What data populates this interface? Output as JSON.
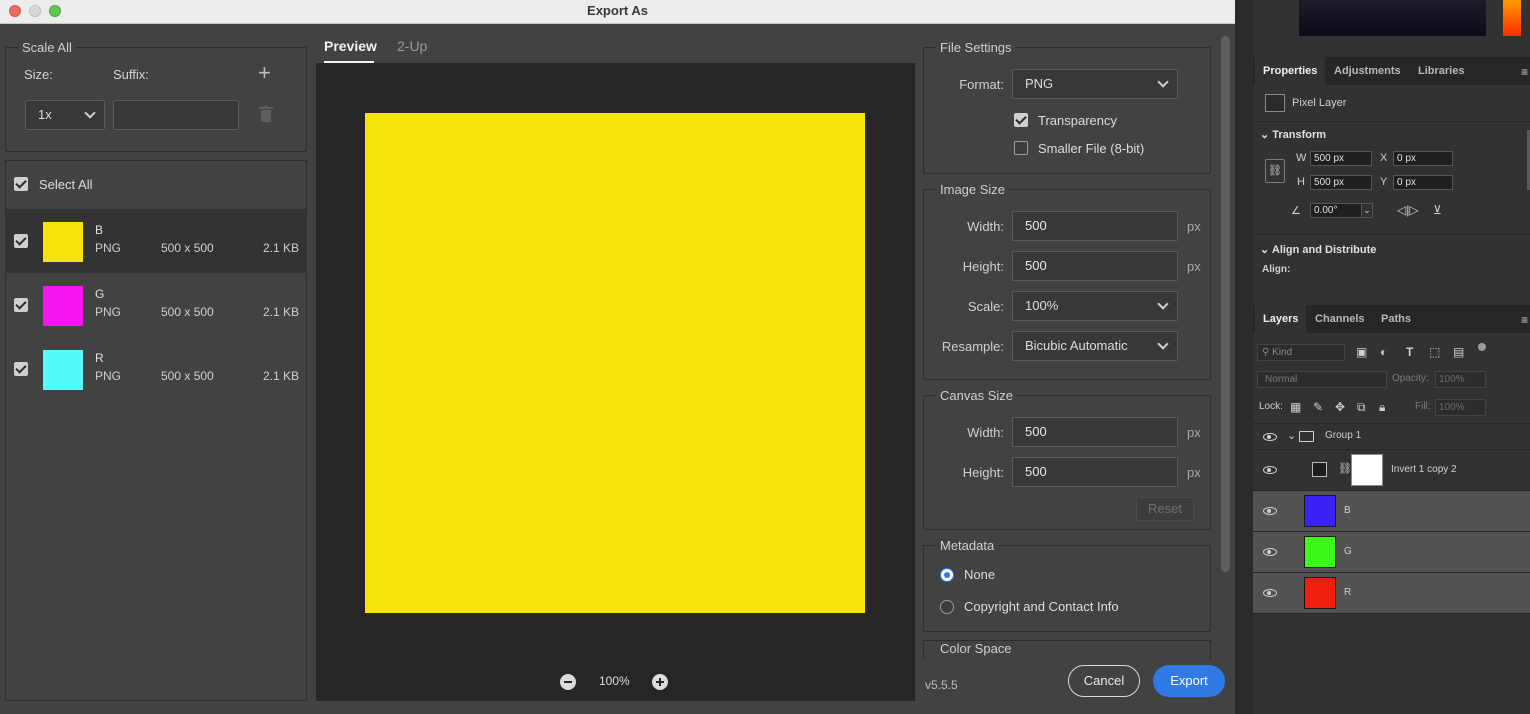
{
  "window": {
    "title": "Export As"
  },
  "scale_all": {
    "legend": "Scale All",
    "size_label": "Size:",
    "suffix_label": "Suffix:",
    "size_value": "1x",
    "suffix_value": ""
  },
  "assets": {
    "select_all": "Select All",
    "items": [
      {
        "name": "B",
        "format": "PNG",
        "dims": "500 x 500",
        "size": "2.1 KB",
        "color": "#f5e30a",
        "checked": true
      },
      {
        "name": "G",
        "format": "PNG",
        "dims": "500 x 500",
        "size": "2.1 KB",
        "color": "#f516f0",
        "checked": true
      },
      {
        "name": "R",
        "format": "PNG",
        "dims": "500 x 500",
        "size": "2.1 KB",
        "color": "#55fbfb",
        "checked": true
      }
    ]
  },
  "preview": {
    "tabs": [
      "Preview",
      "2-Up"
    ],
    "image_color": "#f5e30a",
    "zoom": "100%"
  },
  "file_settings": {
    "legend": "File Settings",
    "format_label": "Format:",
    "format_value": "PNG",
    "transparency": "Transparency",
    "smaller_file": "Smaller File (8-bit)"
  },
  "image_size": {
    "legend": "Image Size",
    "width_label": "Width:",
    "width": "500",
    "height_label": "Height:",
    "height": "500",
    "unit": "px",
    "scale_label": "Scale:",
    "scale": "100%",
    "resample_label": "Resample:",
    "resample": "Bicubic Automatic"
  },
  "canvas_size": {
    "legend": "Canvas Size",
    "width_label": "Width:",
    "width": "500",
    "height_label": "Height:",
    "height": "500",
    "unit": "px",
    "reset": "Reset"
  },
  "metadata": {
    "legend": "Metadata",
    "none": "None",
    "copyright": "Copyright and Contact Info"
  },
  "color_space": {
    "legend": "Color Space"
  },
  "footer": {
    "version": "v5.5.5",
    "cancel": "Cancel",
    "export": "Export"
  },
  "ps": {
    "props_tabs": [
      "Properties",
      "Adjustments",
      "Libraries"
    ],
    "pixel_layer": "Pixel Layer",
    "transform": "Transform",
    "w_label": "W",
    "w": "500 px",
    "h_label": "H",
    "h": "500 px",
    "x_label": "X",
    "x": "0 px",
    "y_label": "Y",
    "y": "0 px",
    "angle": "0.00°",
    "align": "Align and Distribute",
    "align_label": "Align:",
    "layers_tabs": [
      "Layers",
      "Channels",
      "Paths"
    ],
    "kind": "Kind",
    "blend": "Normal",
    "opacity_label": "Opacity:",
    "opacity": "100%",
    "lock_label": "Lock:",
    "fill_label": "Fill:",
    "fill": "100%",
    "layers": [
      {
        "name": "Group 1"
      },
      {
        "name": "Invert 1 copy 2"
      },
      {
        "name": "B",
        "color": "#3a22f5"
      },
      {
        "name": "G",
        "color": "#3cf91a"
      },
      {
        "name": "R",
        "color": "#ef1e0e"
      }
    ]
  }
}
